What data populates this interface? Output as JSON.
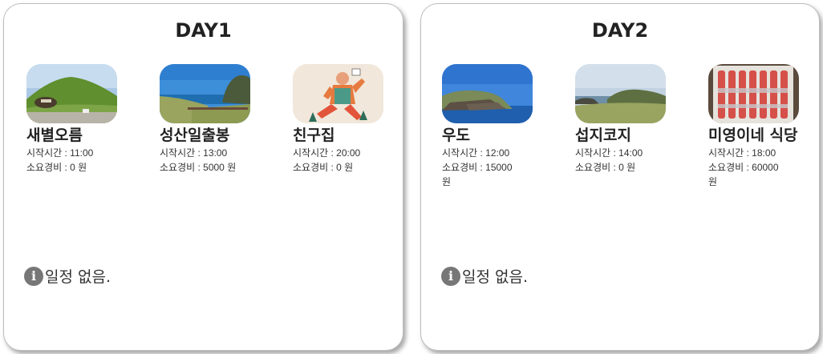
{
  "day1": {
    "title": "DAY1",
    "places": [
      {
        "name": "새별오름",
        "start": "시작시간 : 11:00",
        "cost": "소요경비 : 0 원"
      },
      {
        "name": "성산일출봉",
        "start": "시작시간 : 13:00",
        "cost": "소요경비 : 5000 원"
      },
      {
        "name": "친구집",
        "start": "시작시간 : 20:00",
        "cost": "소요경비 : 0 원"
      }
    ],
    "empty_text": "일정 없음."
  },
  "day2": {
    "title": "DAY2",
    "places": [
      {
        "name": "우도",
        "start": "시작시간 : 12:00",
        "cost": "소요경비 : 15000 원"
      },
      {
        "name": "섭지코지",
        "start": "시작시간 : 14:00",
        "cost": "소요경비 : 0 원"
      },
      {
        "name": "미영이네 식당",
        "start": "시작시간 : 18:00",
        "cost": "소요경비 : 60000 원"
      }
    ],
    "empty_text": "일정 없음."
  },
  "icons": {
    "info": "info-icon"
  },
  "colors": {
    "info_icon": "#777777",
    "card_border": "#bdbdbd"
  }
}
